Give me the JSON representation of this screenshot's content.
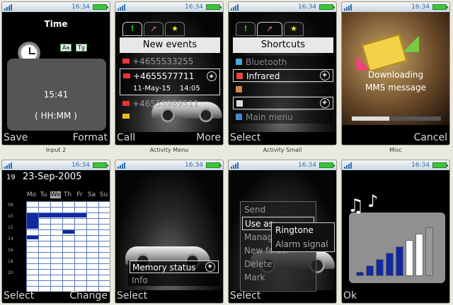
{
  "status": {
    "time": "16:34"
  },
  "screens": [
    {
      "caption": "Input 2",
      "title": "Time",
      "mode_left": "Aa",
      "mode_right": "Tg",
      "value": "15:41",
      "format_hint": "( HH:MM )",
      "soft_left": "Save",
      "soft_right": "Format"
    },
    {
      "caption": "Activity Menu",
      "title": "New events",
      "events": [
        {
          "text": "+4655533255",
          "time": ""
        },
        {
          "text": "+4655577711",
          "time": "11-May-15    14:05"
        },
        {
          "text": "+46555989511",
          "time": ""
        }
      ],
      "soft_left": "Call",
      "soft_right": "More"
    },
    {
      "caption": "Activity Small",
      "title": "Shortcuts",
      "items": [
        "Bluetooth",
        "Infrared",
        "",
        "",
        "Main menu"
      ],
      "soft_left": "Select",
      "soft_right": ""
    },
    {
      "caption": "Misc",
      "line1": "Downloading",
      "line2": "MMS message",
      "progress": 0.42,
      "soft_left": "",
      "soft_right": "Cancel"
    },
    {
      "caption": "",
      "week": "19",
      "date": "23-Sep-2005",
      "days": [
        "Mo",
        "Tu",
        "We",
        "Th",
        "Fr",
        "Sa",
        "Su"
      ],
      "hours": [
        "08",
        "10",
        "12",
        "14",
        "16",
        "18",
        "20"
      ],
      "soft_left": "Select",
      "soft_right": "Change"
    },
    {
      "caption": "",
      "items": [
        "Memory status",
        "Info"
      ],
      "soft_left": "Select",
      "soft_right": ""
    },
    {
      "caption": "",
      "menu": [
        "Send",
        "Use as",
        "Manage",
        "New folder",
        "Delete",
        "Mark"
      ],
      "submenu": [
        "Ringtone",
        "Alarm signal"
      ],
      "soft_left": "Select",
      "soft_right": ""
    },
    {
      "caption": "",
      "volume_level": 7,
      "volume_max": 8,
      "soft_left": "Ok",
      "soft_right": ""
    }
  ],
  "colors": {
    "accent": "#2a6fb0",
    "highlight": "#1028a0"
  }
}
